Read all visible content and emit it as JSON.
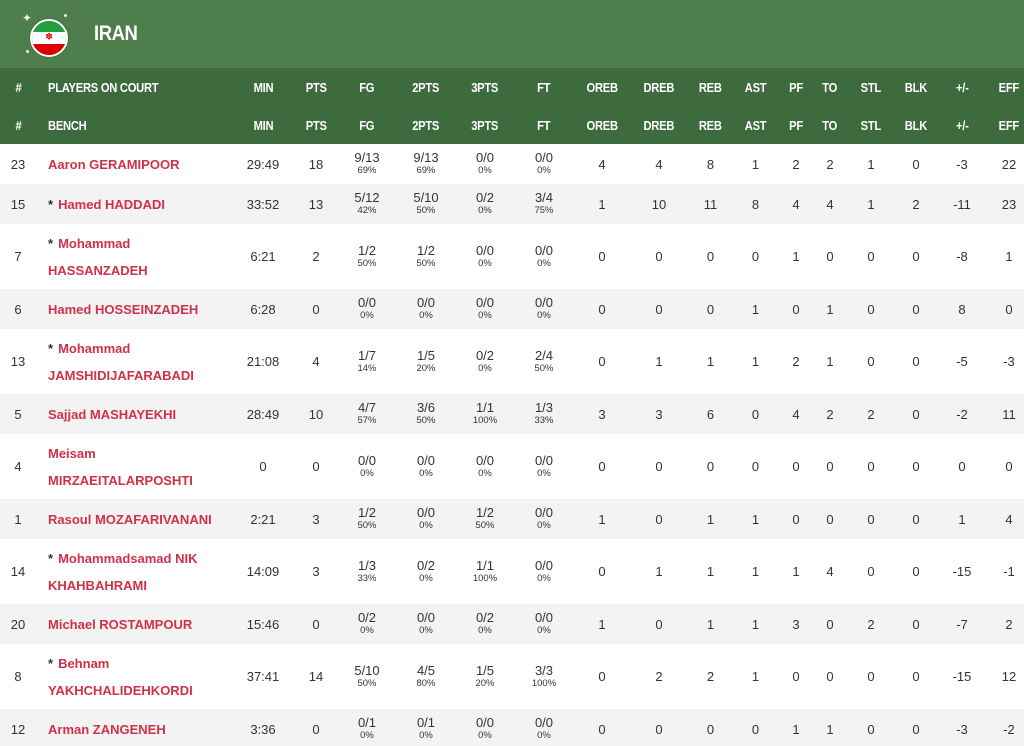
{
  "team": {
    "name": "IRAN",
    "flag_icon": "iran-flag-icon",
    "colors": {
      "header_bg": "#4e7e4c",
      "table_header_bg": "#3e6b3d",
      "player_name": "#d1304a"
    }
  },
  "headers": {
    "on_court": [
      "#",
      "PLAYERS ON COURT",
      "MIN",
      "PTS",
      "FG",
      "2PTS",
      "3PTS",
      "FT",
      "OREB",
      "DREB",
      "REB",
      "AST",
      "PF",
      "TO",
      "STL",
      "BLK",
      "+/-",
      "EFF"
    ],
    "bench": [
      "#",
      "BENCH",
      "MIN",
      "PTS",
      "FG",
      "2PTS",
      "3PTS",
      "FT",
      "OREB",
      "DREB",
      "REB",
      "AST",
      "PF",
      "TO",
      "STL",
      "BLK",
      "+/-",
      "EFF"
    ]
  },
  "players": [
    {
      "num": "23",
      "starter": false,
      "name_lines": [
        "Aaron GERAMIPOOR"
      ],
      "min": "29:49",
      "pts": "18",
      "fg": "9/13",
      "fg_pct": "69%",
      "p2": "9/13",
      "p2_pct": "69%",
      "p3": "0/0",
      "p3_pct": "0%",
      "ft": "0/0",
      "ft_pct": "0%",
      "oreb": "4",
      "dreb": "4",
      "reb": "8",
      "ast": "1",
      "pf": "2",
      "to": "2",
      "stl": "1",
      "blk": "0",
      "pm": "-3",
      "eff": "22"
    },
    {
      "num": "15",
      "starter": true,
      "name_lines": [
        "Hamed HADDADI"
      ],
      "min": "33:52",
      "pts": "13",
      "fg": "5/12",
      "fg_pct": "42%",
      "p2": "5/10",
      "p2_pct": "50%",
      "p3": "0/2",
      "p3_pct": "0%",
      "ft": "3/4",
      "ft_pct": "75%",
      "oreb": "1",
      "dreb": "10",
      "reb": "11",
      "ast": "8",
      "pf": "4",
      "to": "4",
      "stl": "1",
      "blk": "2",
      "pm": "-11",
      "eff": "23"
    },
    {
      "num": "7",
      "starter": true,
      "name_lines": [
        "Mohammad",
        "HASSANZADEH"
      ],
      "min": "6:21",
      "pts": "2",
      "fg": "1/2",
      "fg_pct": "50%",
      "p2": "1/2",
      "p2_pct": "50%",
      "p3": "0/0",
      "p3_pct": "0%",
      "ft": "0/0",
      "ft_pct": "0%",
      "oreb": "0",
      "dreb": "0",
      "reb": "0",
      "ast": "0",
      "pf": "1",
      "to": "0",
      "stl": "0",
      "blk": "0",
      "pm": "-8",
      "eff": "1"
    },
    {
      "num": "6",
      "starter": false,
      "name_lines": [
        "Hamed HOSSEINZADEH"
      ],
      "min": "6:28",
      "pts": "0",
      "fg": "0/0",
      "fg_pct": "0%",
      "p2": "0/0",
      "p2_pct": "0%",
      "p3": "0/0",
      "p3_pct": "0%",
      "ft": "0/0",
      "ft_pct": "0%",
      "oreb": "0",
      "dreb": "0",
      "reb": "0",
      "ast": "1",
      "pf": "0",
      "to": "1",
      "stl": "0",
      "blk": "0",
      "pm": "8",
      "eff": "0"
    },
    {
      "num": "13",
      "starter": true,
      "name_lines": [
        "Mohammad",
        "JAMSHIDIJAFARABADI"
      ],
      "min": "21:08",
      "pts": "4",
      "fg": "1/7",
      "fg_pct": "14%",
      "p2": "1/5",
      "p2_pct": "20%",
      "p3": "0/2",
      "p3_pct": "0%",
      "ft": "2/4",
      "ft_pct": "50%",
      "oreb": "0",
      "dreb": "1",
      "reb": "1",
      "ast": "1",
      "pf": "2",
      "to": "1",
      "stl": "0",
      "blk": "0",
      "pm": "-5",
      "eff": "-3"
    },
    {
      "num": "5",
      "starter": false,
      "name_lines": [
        "Sajjad MASHAYEKHI"
      ],
      "min": "28:49",
      "pts": "10",
      "fg": "4/7",
      "fg_pct": "57%",
      "p2": "3/6",
      "p2_pct": "50%",
      "p3": "1/1",
      "p3_pct": "100%",
      "ft": "1/3",
      "ft_pct": "33%",
      "oreb": "3",
      "dreb": "3",
      "reb": "6",
      "ast": "0",
      "pf": "4",
      "to": "2",
      "stl": "2",
      "blk": "0",
      "pm": "-2",
      "eff": "11"
    },
    {
      "num": "4",
      "starter": false,
      "name_lines": [
        "Meisam",
        "MIRZAEITALARPOSHTI"
      ],
      "min": "0",
      "pts": "0",
      "fg": "0/0",
      "fg_pct": "0%",
      "p2": "0/0",
      "p2_pct": "0%",
      "p3": "0/0",
      "p3_pct": "0%",
      "ft": "0/0",
      "ft_pct": "0%",
      "oreb": "0",
      "dreb": "0",
      "reb": "0",
      "ast": "0",
      "pf": "0",
      "to": "0",
      "stl": "0",
      "blk": "0",
      "pm": "0",
      "eff": "0"
    },
    {
      "num": "1",
      "starter": false,
      "name_lines": [
        "Rasoul MOZAFARIVANANI"
      ],
      "min": "2:21",
      "pts": "3",
      "fg": "1/2",
      "fg_pct": "50%",
      "p2": "0/0",
      "p2_pct": "0%",
      "p3": "1/2",
      "p3_pct": "50%",
      "ft": "0/0",
      "ft_pct": "0%",
      "oreb": "1",
      "dreb": "0",
      "reb": "1",
      "ast": "1",
      "pf": "0",
      "to": "0",
      "stl": "0",
      "blk": "0",
      "pm": "1",
      "eff": "4"
    },
    {
      "num": "14",
      "starter": true,
      "name_lines": [
        "Mohammadsamad NIK",
        "KHAHBAHRAMI"
      ],
      "min": "14:09",
      "pts": "3",
      "fg": "1/3",
      "fg_pct": "33%",
      "p2": "0/2",
      "p2_pct": "0%",
      "p3": "1/1",
      "p3_pct": "100%",
      "ft": "0/0",
      "ft_pct": "0%",
      "oreb": "0",
      "dreb": "1",
      "reb": "1",
      "ast": "1",
      "pf": "1",
      "to": "4",
      "stl": "0",
      "blk": "0",
      "pm": "-15",
      "eff": "-1"
    },
    {
      "num": "20",
      "starter": false,
      "name_lines": [
        "Michael ROSTAMPOUR"
      ],
      "min": "15:46",
      "pts": "0",
      "fg": "0/2",
      "fg_pct": "0%",
      "p2": "0/0",
      "p2_pct": "0%",
      "p3": "0/2",
      "p3_pct": "0%",
      "ft": "0/0",
      "ft_pct": "0%",
      "oreb": "1",
      "dreb": "0",
      "reb": "1",
      "ast": "1",
      "pf": "3",
      "to": "0",
      "stl": "2",
      "blk": "0",
      "pm": "-7",
      "eff": "2"
    },
    {
      "num": "8",
      "starter": true,
      "name_lines": [
        "Behnam",
        "YAKHCHALIDEHKORDI"
      ],
      "min": "37:41",
      "pts": "14",
      "fg": "5/10",
      "fg_pct": "50%",
      "p2": "4/5",
      "p2_pct": "80%",
      "p3": "1/5",
      "p3_pct": "20%",
      "ft": "3/3",
      "ft_pct": "100%",
      "oreb": "0",
      "dreb": "2",
      "reb": "2",
      "ast": "1",
      "pf": "0",
      "to": "0",
      "stl": "0",
      "blk": "0",
      "pm": "-15",
      "eff": "12"
    },
    {
      "num": "12",
      "starter": false,
      "name_lines": [
        "Arman ZANGENEH"
      ],
      "min": "3:36",
      "pts": "0",
      "fg": "0/1",
      "fg_pct": "0%",
      "p2": "0/1",
      "p2_pct": "0%",
      "p3": "0/0",
      "p3_pct": "0%",
      "ft": "0/0",
      "ft_pct": "0%",
      "oreb": "0",
      "dreb": "0",
      "reb": "0",
      "ast": "0",
      "pf": "1",
      "to": "1",
      "stl": "0",
      "blk": "0",
      "pm": "-3",
      "eff": "-2"
    }
  ]
}
